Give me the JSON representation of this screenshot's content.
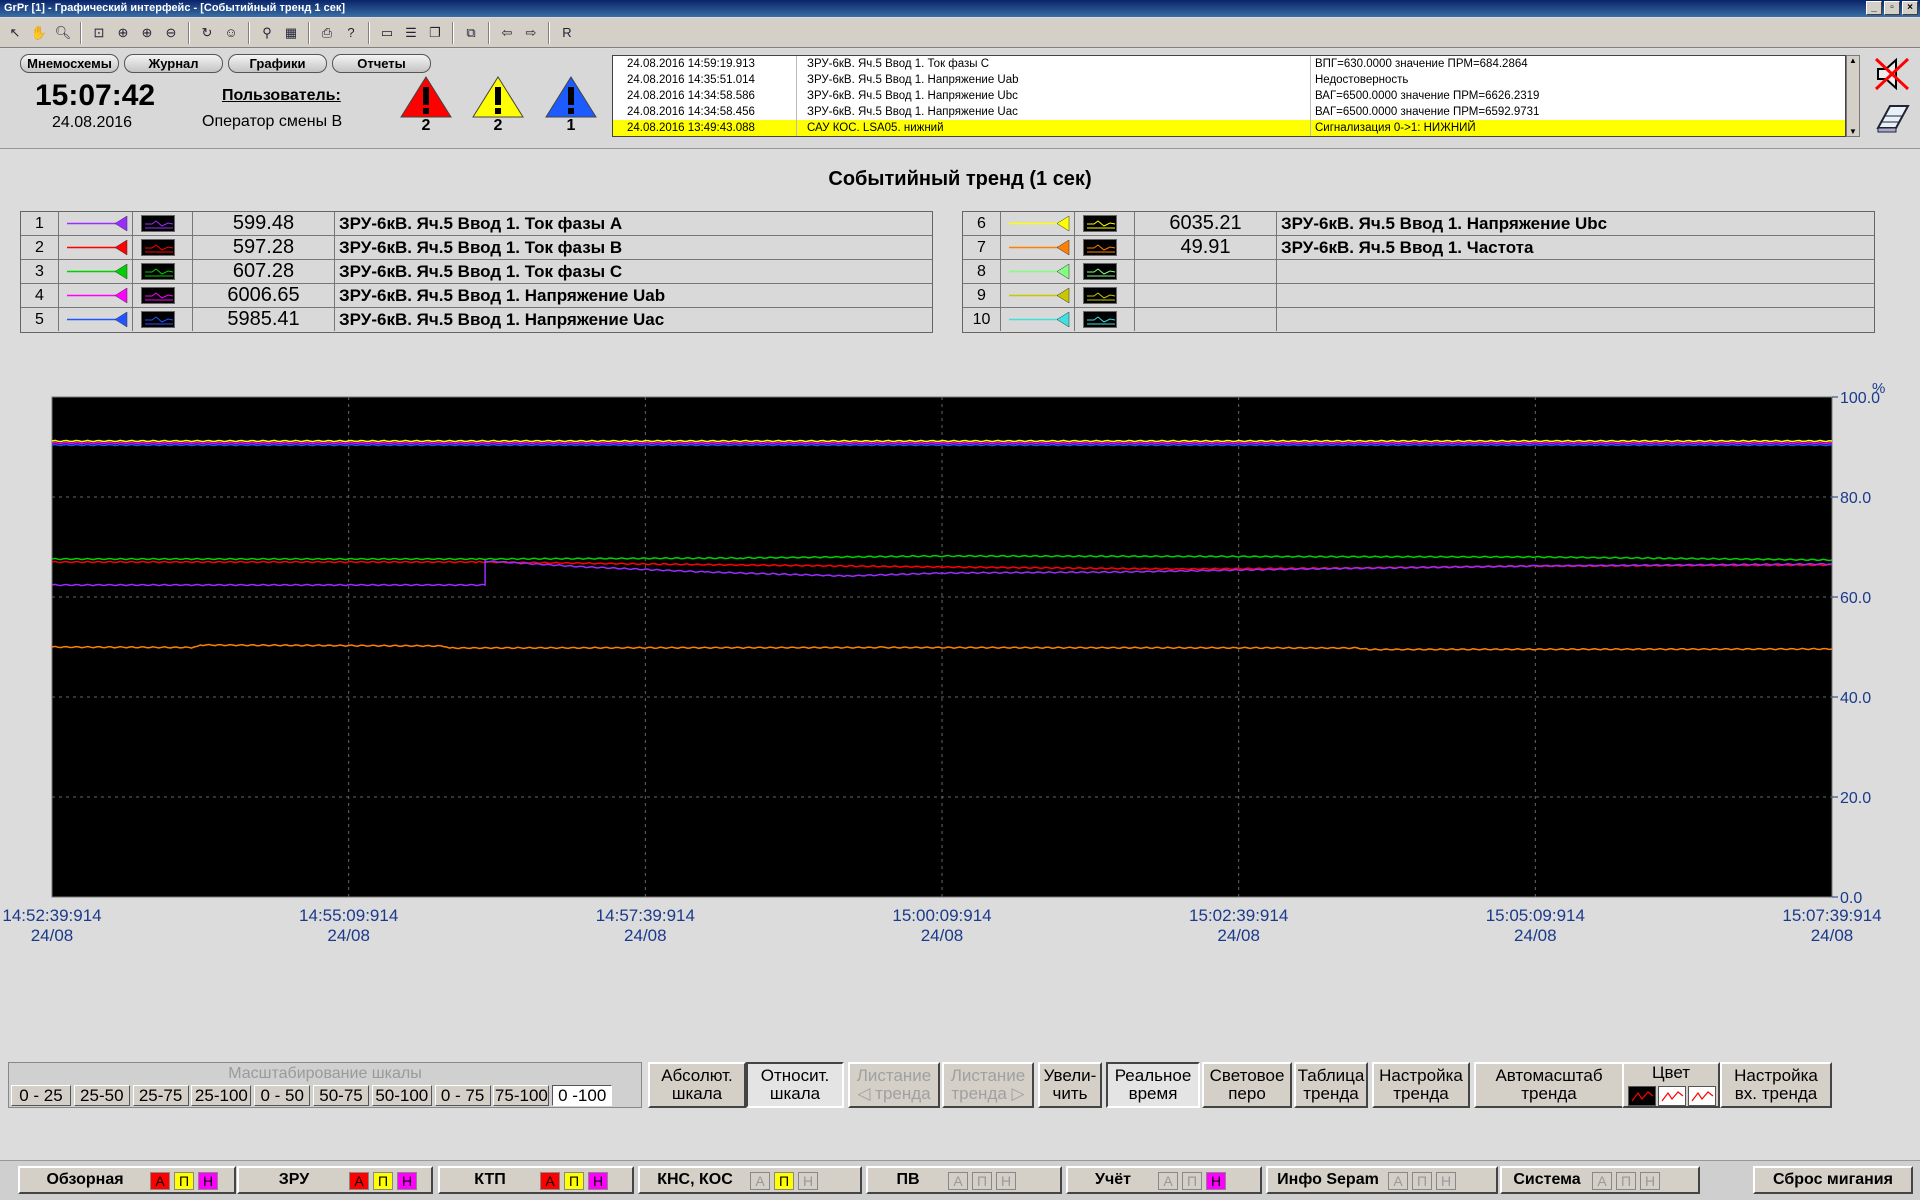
{
  "window": {
    "title": "GrPr [1] - Графический интерфейс - [Событийный тренд 1 сек]",
    "controls": [
      "_",
      "▫",
      "×"
    ]
  },
  "toolbar": {
    "last_label": "R"
  },
  "nav": [
    "Мнемосхемы",
    "Журнал",
    "Графики",
    "Отчеты"
  ],
  "clock": {
    "time": "15:07:42",
    "date": "24.08.2016"
  },
  "user": {
    "label": "Пользователь:",
    "name": "Оператор смены  В"
  },
  "alarms": [
    {
      "color": "#ff0000",
      "count": "2"
    },
    {
      "color": "#ffff00",
      "count": "2"
    },
    {
      "color": "#1e5bff",
      "count": "1"
    }
  ],
  "events": [
    {
      "time": "24.08.2016 14:59:19.913",
      "source": "ЗРУ-6кВ. Яч.5 Ввод 1. Ток фазы С",
      "message": "ВПГ=630.0000  значение ПРМ=684.2864",
      "highlight": false
    },
    {
      "time": "24.08.2016 14:35:51.014",
      "source": "ЗРУ-6кВ. Яч.5 Ввод 1. Напряжение Uab",
      "message": "Недостоверность",
      "highlight": false
    },
    {
      "time": "24.08.2016 14:34:58.586",
      "source": "ЗРУ-6кВ. Яч.5 Ввод 1. Напряжение Ubc",
      "message": "ВАГ=6500.0000  значение ПРМ=6626.2319",
      "highlight": false
    },
    {
      "time": "24.08.2016 14:34:58.456",
      "source": "ЗРУ-6кВ. Яч.5 Ввод 1. Напряжение Uac",
      "message": "ВАГ=6500.0000  значение ПРМ=6592.9731",
      "highlight": false
    },
    {
      "time": "24.08.2016 13:49:43.088",
      "source": "САУ КОС. LSA05. нижний",
      "message": "Сигнализация  0->1:    НИЖНИЙ",
      "highlight": true
    }
  ],
  "trend": {
    "title": "Событийный тренд (1 сек)"
  },
  "legend_left": [
    {
      "num": "1",
      "color": "#9a2cff",
      "value": "599.48",
      "name": "ЗРУ-6кВ. Яч.5 Ввод 1. Ток фазы А"
    },
    {
      "num": "2",
      "color": "#ff0000",
      "value": "597.28",
      "name": "ЗРУ-6кВ. Яч.5 Ввод 1. Ток фазы В"
    },
    {
      "num": "3",
      "color": "#00d000",
      "value": "607.28",
      "name": "ЗРУ-6кВ. Яч.5 Ввод 1. Ток фазы С"
    },
    {
      "num": "4",
      "color": "#ff00ff",
      "value": "6006.65",
      "name": "ЗРУ-6кВ. Яч.5 Ввод 1. Напряжение Uab"
    },
    {
      "num": "5",
      "color": "#2255ff",
      "value": "5985.41",
      "name": "ЗРУ-6кВ. Яч.5 Ввод 1. Напряжение Uac"
    }
  ],
  "legend_right": [
    {
      "num": "6",
      "color": "#ffff00",
      "value": "6035.21",
      "name": "ЗРУ-6кВ. Яч.5 Ввод 1. Напряжение Ubc"
    },
    {
      "num": "7",
      "color": "#ff8000",
      "value": "49.91",
      "name": "ЗРУ-6кВ. Яч.5 Ввод 1. Частота"
    },
    {
      "num": "8",
      "color": "#80ff80",
      "value": "",
      "name": ""
    },
    {
      "num": "9",
      "color": "#c8c800",
      "value": "",
      "name": ""
    },
    {
      "num": "10",
      "color": "#40e0e0",
      "value": "",
      "name": ""
    }
  ],
  "chart_data": {
    "type": "line",
    "y_unit": "%",
    "ylim": [
      0,
      100
    ],
    "y_ticks": [
      "100.0",
      "80.0",
      "60.0",
      "40.0",
      "20.0",
      "0.0"
    ],
    "x_ticks": [
      {
        "time": "14:52:39:914",
        "date": "24/08"
      },
      {
        "time": "14:55:09:914",
        "date": "24/08"
      },
      {
        "time": "14:57:39:914",
        "date": "24/08"
      },
      {
        "time": "15:00:09:914",
        "date": "24/08"
      },
      {
        "time": "15:02:39:914",
        "date": "24/08"
      },
      {
        "time": "15:05:09:914",
        "date": "24/08"
      },
      {
        "time": "15:07:39:914",
        "date": "24/08"
      }
    ],
    "x_minutes": [
      0,
      2.5,
      5,
      7.5,
      10,
      12.5,
      15
    ],
    "grid": true,
    "background": "#000000",
    "series": [
      {
        "color": "#ffff00",
        "points": [
          [
            0,
            91.2
          ],
          [
            15,
            91.2
          ]
        ]
      },
      {
        "color": "#ff00ff",
        "points": [
          [
            0,
            90.8
          ],
          [
            15,
            90.8
          ]
        ]
      },
      {
        "color": "#2255ff",
        "points": [
          [
            0,
            90.4
          ],
          [
            15,
            90.4
          ]
        ]
      },
      {
        "color": "#00d000",
        "points": [
          [
            0,
            67.6
          ],
          [
            3.6,
            67.6
          ],
          [
            5.8,
            67.8
          ],
          [
            7.5,
            68.2
          ],
          [
            12.5,
            68.0
          ],
          [
            15,
            67.4
          ]
        ]
      },
      {
        "color": "#ff0000",
        "points": [
          [
            0,
            67.0
          ],
          [
            3.6,
            67.0
          ],
          [
            5,
            66.6
          ],
          [
            7.5,
            66.0
          ],
          [
            9.5,
            65.6
          ],
          [
            11,
            65.8
          ],
          [
            12.5,
            66.2
          ],
          [
            15,
            66.4
          ]
        ]
      },
      {
        "color": "#9a2cff",
        "points": [
          [
            0,
            62.4
          ],
          [
            3.65,
            62.4
          ],
          [
            3.65,
            67.2
          ],
          [
            4.5,
            66.0
          ],
          [
            5.5,
            65.0
          ],
          [
            6.7,
            64.2
          ],
          [
            7.5,
            64.8
          ],
          [
            9,
            65.0
          ],
          [
            10.5,
            65.6
          ],
          [
            12.5,
            66.2
          ],
          [
            15,
            66.6
          ]
        ]
      },
      {
        "color": "#ff8000",
        "points": [
          [
            0,
            50.0
          ],
          [
            1.2,
            49.9
          ],
          [
            1.25,
            50.4
          ],
          [
            3.3,
            50.2
          ],
          [
            3.35,
            49.8
          ],
          [
            7,
            49.9
          ],
          [
            11,
            49.8
          ],
          [
            11.1,
            49.5
          ],
          [
            15,
            49.6
          ]
        ]
      }
    ]
  },
  "scale": {
    "title": "Масштабирование шкалы",
    "options": [
      "0 - 25",
      "25-50",
      "25-75",
      "25-100",
      "0 - 50",
      "50-75",
      "50-100",
      "0 - 75",
      "75-100",
      "0 -100"
    ],
    "active_index": 9
  },
  "controls": [
    {
      "label": "Абсолют.\nшкала",
      "state": "normal"
    },
    {
      "label": "Относит.\nшкала",
      "state": "pressed"
    },
    {
      "label": "Листание\n◁ тренда",
      "state": "disabled"
    },
    {
      "label": "Листание\nтренда ▷",
      "state": "disabled"
    },
    {
      "label": "Увели-\nчить",
      "state": "normal"
    },
    {
      "label": "Реальное\nвремя",
      "state": "pressed"
    },
    {
      "label": "Световое\nперо",
      "state": "normal"
    },
    {
      "label": "Таблица\nтренда",
      "state": "normal"
    },
    {
      "label": "Настройка\nтренда",
      "state": "normal"
    },
    {
      "label": "Автомасштаб\nтренда",
      "state": "normal"
    },
    {
      "label": "Настройка\nвх. тренда",
      "state": "normal"
    }
  ],
  "color_group": {
    "label": "Цвет",
    "swatches": [
      "#000000",
      "#ffffff",
      "#ffffff"
    ]
  },
  "bottom_groups": [
    {
      "label": "Обзорная",
      "ind": [
        "a",
        "p",
        "n"
      ]
    },
    {
      "label": "ЗРУ",
      "ind": [
        "a",
        "p",
        "n"
      ]
    },
    {
      "label": "КТП",
      "ind": [
        "a",
        "p",
        "n"
      ]
    },
    {
      "label": "КНС, КОС",
      "ind": [
        "",
        "p",
        ""
      ]
    },
    {
      "label": "ПВ",
      "ind": [
        "",
        "",
        ""
      ]
    },
    {
      "label": "Учёт",
      "ind": [
        "",
        "",
        "n"
      ]
    },
    {
      "label": "Инфо Sepam",
      "ind": [
        "",
        "",
        ""
      ]
    },
    {
      "label": "Система",
      "ind": [
        "",
        "",
        ""
      ]
    }
  ],
  "indicator_letters": [
    "А",
    "П",
    "Н"
  ],
  "reset_label": "Сброс мигания"
}
